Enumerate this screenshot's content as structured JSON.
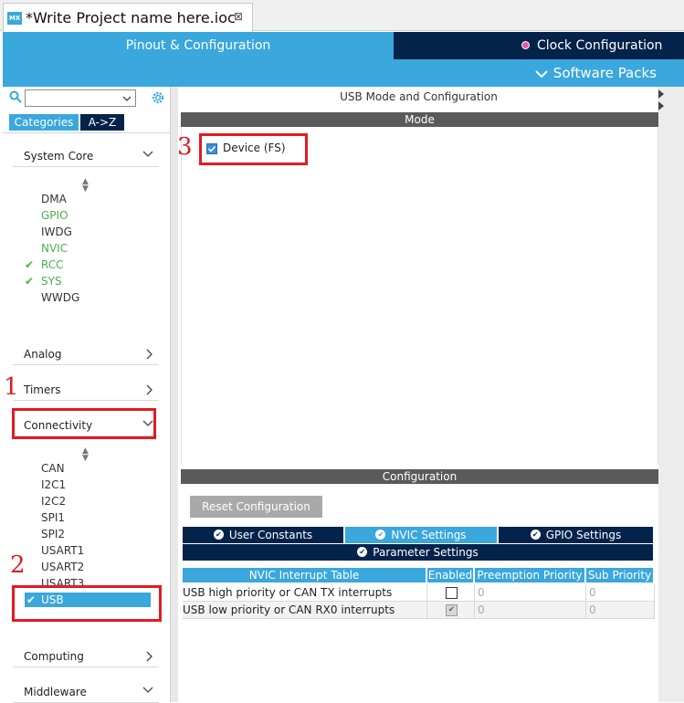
{
  "file_tab": {
    "icon_text": "MX",
    "title": "*Write Project name here.ioc",
    "close": "⊠"
  },
  "main_tabs": {
    "pinout": "Pinout & Configuration",
    "clock": "Clock Configuration"
  },
  "software_packs": "Software Packs",
  "sidebar": {
    "tab_categories": "Categories",
    "tab_az": "A->Z",
    "sections": [
      {
        "label": "System Core",
        "expanded": true,
        "items": [
          {
            "label": "DMA",
            "status": "none"
          },
          {
            "label": "GPIO",
            "status": "green"
          },
          {
            "label": "IWDG",
            "status": "none"
          },
          {
            "label": "NVIC",
            "status": "green"
          },
          {
            "label": "RCC",
            "status": "check"
          },
          {
            "label": "SYS",
            "status": "check"
          },
          {
            "label": "WWDG",
            "status": "none"
          }
        ]
      },
      {
        "label": "Analog",
        "expanded": false
      },
      {
        "label": "Timers",
        "expanded": false
      },
      {
        "label": "Connectivity",
        "expanded": true,
        "items": [
          {
            "label": "CAN"
          },
          {
            "label": "I2C1"
          },
          {
            "label": "I2C2"
          },
          {
            "label": "SPI1"
          },
          {
            "label": "SPI2"
          },
          {
            "label": "USART1"
          },
          {
            "label": "USART2"
          },
          {
            "label": "USART3"
          },
          {
            "label": "USB",
            "selected": true
          }
        ]
      },
      {
        "label": "Computing",
        "expanded": false
      },
      {
        "label": "Middleware",
        "expanded": true
      }
    ]
  },
  "panel": {
    "header": "USB Mode and Configuration",
    "mode_title": "Mode",
    "device_label": "Device (FS)",
    "device_checked": true,
    "config_title": "Configuration",
    "reset_button": "Reset Configuration",
    "tabs": [
      "User Constants",
      "NVIC Settings",
      "GPIO Settings",
      "Parameter Settings"
    ],
    "active_tab": "NVIC Settings",
    "table": {
      "headers": [
        "NVIC Interrupt Table",
        "Enabled",
        "Preemption Priority",
        "Sub Priority"
      ],
      "rows": [
        {
          "name": "USB high priority or CAN TX interrupts",
          "enabled": false,
          "preemption": "0",
          "sub": "0"
        },
        {
          "name": "USB low priority or CAN RX0 interrupts",
          "enabled": true,
          "preemption": "0",
          "sub": "0"
        }
      ]
    }
  },
  "annotations": [
    "1",
    "2",
    "3"
  ],
  "colors": {
    "accent": "#3aa7dd",
    "navy": "#03234b",
    "annotation_red": "#e21b22",
    "enabled_green": "#4cae4c"
  }
}
